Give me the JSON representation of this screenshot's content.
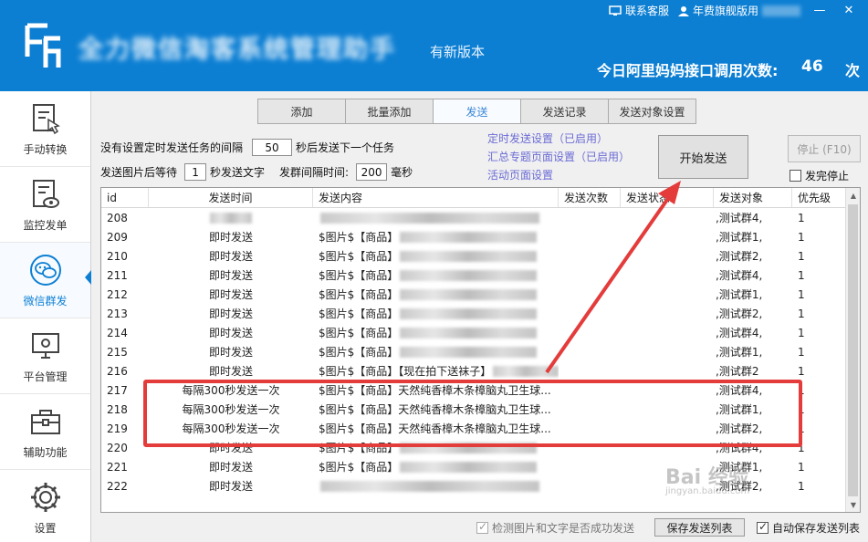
{
  "header": {
    "title": "全力微信淘客系统管理助手",
    "new_version": "有新版本",
    "support": "联系客服",
    "edition": "年费旗舰版用",
    "api_label": "今日阿里妈妈接口调用次数:",
    "api_count": "46",
    "api_unit": "次",
    "minimize": "—",
    "close": "✕"
  },
  "sidebar": {
    "items": [
      {
        "label": "手动转换",
        "icon": "manual-convert-icon"
      },
      {
        "label": "监控发单",
        "icon": "monitor-icon"
      },
      {
        "label": "微信群发",
        "icon": "wechat-icon"
      },
      {
        "label": "平台管理",
        "icon": "platform-icon"
      },
      {
        "label": "辅助功能",
        "icon": "toolbox-icon"
      },
      {
        "label": "设置",
        "icon": "settings-icon"
      }
    ]
  },
  "tabs": [
    "添加",
    "批量添加",
    "发送",
    "发送记录",
    "发送对象设置"
  ],
  "controls": {
    "interval_prefix": "没有设置定时发送任务的间隔",
    "interval_value": "50",
    "interval_suffix": "秒后发送下一个任务",
    "wait_prefix": "发送图片后等待",
    "wait_value": "1",
    "wait_suffix": "秒发送文字",
    "group_prefix": "发群间隔时间:",
    "group_value": "200",
    "group_suffix": "毫秒"
  },
  "links": {
    "schedule": "定时发送设置（已启用）",
    "topic": "汇总专题页面设置（已启用）",
    "activity": "活动页面设置"
  },
  "buttons": {
    "start": "开始发送",
    "stop": "停止 (F10)",
    "stop_after_finish": "发完停止",
    "save_list": "保存发送列表",
    "check_image_text": "检测图片和文字是否成功发送",
    "auto_save": "自动保存发送列表"
  },
  "table": {
    "columns": [
      "id",
      "发送时间",
      "发送内容",
      "发送次数",
      "发送状态",
      "发送对象",
      "优先级"
    ],
    "rows": [
      {
        "id": "208",
        "time": "",
        "content": "",
        "target": ",测试群4,",
        "prio": "1"
      },
      {
        "id": "209",
        "time": "即时发送",
        "content": "$图片$【商品】",
        "target": ",测试群1,",
        "prio": "1"
      },
      {
        "id": "210",
        "time": "即时发送",
        "content": "$图片$【商品】",
        "target": ",测试群2,",
        "prio": "1"
      },
      {
        "id": "211",
        "time": "即时发送",
        "content": "$图片$【商品】",
        "target": ",测试群4,",
        "prio": "1"
      },
      {
        "id": "212",
        "time": "即时发送",
        "content": "$图片$【商品】",
        "target": ",测试群1,",
        "prio": "1"
      },
      {
        "id": "213",
        "time": "即时发送",
        "content": "$图片$【商品】",
        "target": ",测试群2,",
        "prio": "1"
      },
      {
        "id": "214",
        "time": "即时发送",
        "content": "$图片$【商品】",
        "target": ",测试群4,",
        "prio": "1"
      },
      {
        "id": "215",
        "time": "即时发送",
        "content": "$图片$【商品】",
        "target": ",测试群1,",
        "prio": "1"
      },
      {
        "id": "216",
        "time": "即时发送",
        "content": "$图片$【商品】【现在拍下送袜子】",
        "target": ",测试群2",
        "prio": "1"
      },
      {
        "id": "217",
        "time": "每隔300秒发送一次",
        "content": "$图片$【商品】天然纯香樟木条樟脑丸卫生球...",
        "target": ",测试群4,",
        "prio": "1"
      },
      {
        "id": "218",
        "time": "每隔300秒发送一次",
        "content": "$图片$【商品】天然纯香樟木条樟脑丸卫生球...",
        "target": ",测试群1,",
        "prio": "1"
      },
      {
        "id": "219",
        "time": "每隔300秒发送一次",
        "content": "$图片$【商品】天然纯香樟木条樟脑丸卫生球...",
        "target": ",测试群2,",
        "prio": "1"
      },
      {
        "id": "220",
        "time": "即时发送",
        "content": "$图片$【商品】",
        "target": ",测试群4,",
        "prio": "1"
      },
      {
        "id": "221",
        "time": "即时发送",
        "content": "$图片$【商品】",
        "target": ",测试群1,",
        "prio": "1"
      },
      {
        "id": "222",
        "time": "即时发送",
        "content": "",
        "target": ",测试群2,",
        "prio": "1"
      }
    ]
  },
  "watermark": {
    "main": "Bai 经验",
    "sub": "jingyan.baidu.com"
  },
  "colors": {
    "brand": "#0d7fd3",
    "highlight": "#e43b3b",
    "link": "#6b6bd6"
  }
}
